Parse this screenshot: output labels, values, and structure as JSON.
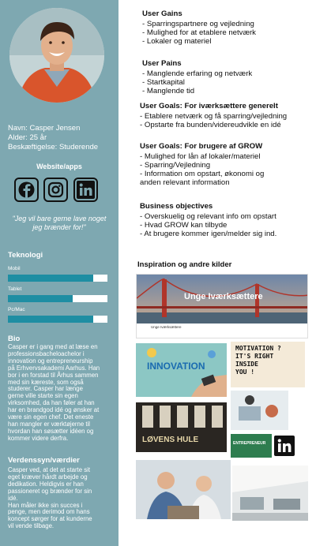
{
  "profile": {
    "name_line": "Navn: Casper Jensen",
    "age_line": "Alder: 25 år",
    "job_line": "Beskæftigelse: Studerende"
  },
  "website": {
    "title": "Website/apps",
    "icons": [
      "facebook-icon",
      "instagram-icon",
      "linkedin-icon"
    ]
  },
  "quote": "\"Jeg vil bare gerne lave noget jeg brænder for!\"",
  "technology": {
    "title": "Teknologi",
    "skills": [
      {
        "label": "Mobil",
        "level": 0.86
      },
      {
        "label": "Tablet",
        "level": 0.65
      },
      {
        "label": "Pc/Mac",
        "level": 0.86
      }
    ]
  },
  "bio": {
    "title": "Bio",
    "text": "Casper er i gang med at læse en\nprofessionsbacheloachelor i\ninnovation og entrepreneurship\npå Erhvervsakademi Aarhus. Han\nbor i en forstad til Århus sammen\nmed sin kæreste, som også\nstuderer. Casper har længe\ngerne ville starte sin egen\nvirksomhed, da han føler at han\nhar en brandgod idé og ønsker at\nvære sin egen chef. Det eneste\nhan mangler er værktøjerne til\nhvordan han søsætter idéen og\nkommer videre derfra."
  },
  "worldview": {
    "title": "Verdenssyn/værdier",
    "text": "Casper ved, at det at starte sit\neget kræver hårdt arbejde og\ndedikation. Heldigvis er han\npassioneret og brænder for sin\nidé.\nHan måler ikke sin succes i\npenge, men derimod om hans\nkoncept sørger for at kunderne\nvil vende tilbage."
  },
  "gains": {
    "title": "User Gains",
    "items": [
      "- Sparringspartnere og vejledning",
      "- Mulighed for at etablere netværk",
      "- Lokaler og materiel"
    ]
  },
  "pains": {
    "title": "User Pains",
    "items": [
      "- Manglende erfaring og netværk",
      "- Startkapital",
      "- Manglende tid"
    ]
  },
  "goals_general": {
    "title": "User Goals: For iværksættere generelt",
    "items": [
      "- Etablere netværk og få sparring/vejledning",
      "- Opstarte fra bunden/videreudvikle en idé"
    ]
  },
  "goals_grow": {
    "title": "User Goals: For brugere af GROW",
    "items": [
      "- Mulighed for lån af lokaler/materiel",
      "- Sparring/Vejledning",
      "- Information om opstart, økonomi og",
      "anden relevant information"
    ]
  },
  "objectives": {
    "title": "Business objectives",
    "items": [
      "- Overskuelig og relevant info om opstart",
      "- Hvad GROW kan tilbyde",
      "- At brugere kommer igen/melder sig ind."
    ]
  },
  "inspiration": {
    "title": "Inspiration og andre kilder",
    "banner_text": "Unge Iværksættere",
    "banner_sub": "Unge Iværksættere",
    "innovation_text": "INNOVATION",
    "motivation_lines": [
      "MOTIVATION ?",
      "IT'S RIGHT",
      "INSIDE",
      "YOU !"
    ],
    "lovens_text": "LØVENS HULE",
    "entre_text": "ENTREPRENEUR"
  },
  "colors": {
    "panel": "#7ea8b1",
    "bar_fill": "#1e8ea3"
  }
}
